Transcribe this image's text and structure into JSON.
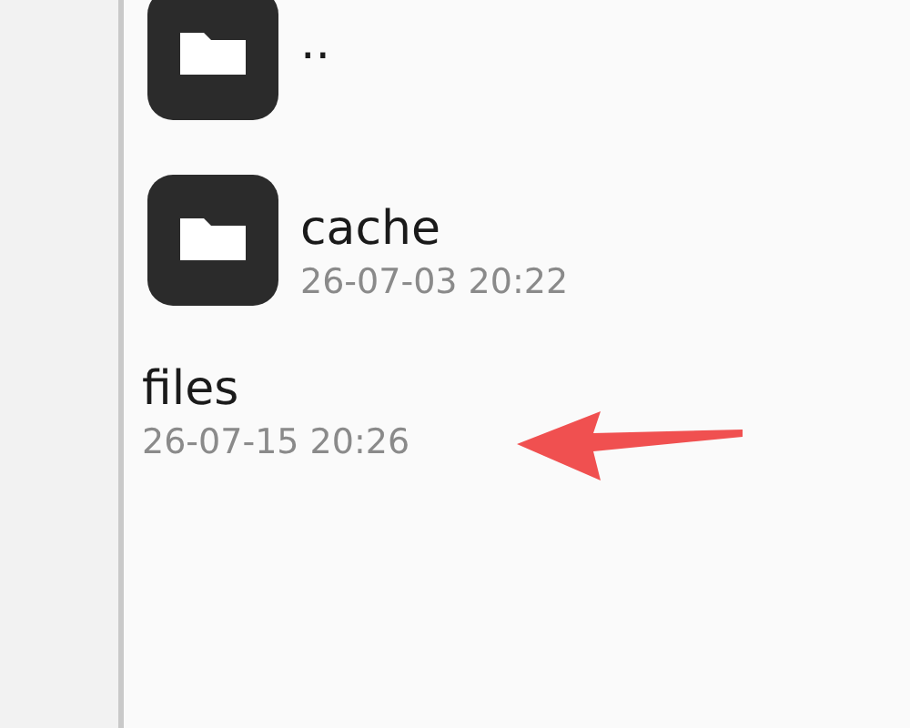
{
  "entries": [
    {
      "kind": "folder",
      "name": ".."
    },
    {
      "kind": "folder",
      "name": "cache",
      "date": "26-07-03 20:22"
    },
    {
      "kind": "plain",
      "name": "files",
      "date": "26-07-15 20:26"
    }
  ]
}
